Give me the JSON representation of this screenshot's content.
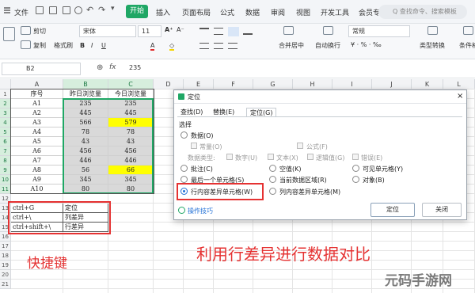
{
  "menubar": {
    "file": "文件",
    "start": "开始",
    "insert": "插入",
    "page_layout": "页面布局",
    "formula": "公式",
    "data": "数据",
    "review": "审阅",
    "view": "视图",
    "dev_tools": "开发工具",
    "member": "会员专",
    "search_placeholder": "Q 查找命令、搜索模板"
  },
  "ribbon": {
    "cut": "剪切",
    "copy": "复制",
    "format_painter": "格式刷",
    "font_name": "宋体",
    "font_size": "11",
    "merge_center": "合并居中",
    "auto_wrap": "自动换行",
    "number_format": "常规",
    "type_convert": "类型转换",
    "cond_format": "条件格"
  },
  "formula_bar": {
    "name_box": "B2",
    "fx": "fx",
    "value": "235"
  },
  "columns": [
    "A",
    "B",
    "C",
    "D",
    "E",
    "F",
    "G",
    "H",
    "I",
    "J",
    "K",
    "L"
  ],
  "rows": [
    "1",
    "2",
    "3",
    "4",
    "5",
    "6",
    "7",
    "8",
    "9",
    "10",
    "11",
    "12",
    "13",
    "14",
    "15",
    "16",
    "17",
    "18",
    "19",
    "20",
    "21"
  ],
  "table": {
    "headers": [
      "序号",
      "昨日浏览量",
      "今日浏览量"
    ],
    "rows": [
      [
        "A1",
        "235",
        "235"
      ],
      [
        "A2",
        "445",
        "445"
      ],
      [
        "A3",
        "566",
        "579"
      ],
      [
        "A4",
        "78",
        "78"
      ],
      [
        "A5",
        "43",
        "43"
      ],
      [
        "A6",
        "456",
        "456"
      ],
      [
        "A7",
        "446",
        "446"
      ],
      [
        "A8",
        "56",
        "66"
      ],
      [
        "A9",
        "345",
        "345"
      ],
      [
        "A10",
        "80",
        "80"
      ]
    ],
    "highlight_color": "#ffff00",
    "selection_fill": "#d9d9d9"
  },
  "shortcuts": [
    [
      "ctrl+G",
      "定位"
    ],
    [
      "ctrl+\\",
      "列差异"
    ],
    [
      "ctrl+shift+\\",
      "行差异"
    ]
  ],
  "dialog": {
    "title": "定位",
    "tabs": [
      "查找(D)",
      "替换(E)",
      "定位(G)"
    ],
    "section": "选择",
    "data_option": "数据(O)",
    "constant": "常量(O)",
    "formula": "公式(F)",
    "data_type": "数据类型:",
    "types": [
      "数字(U)",
      "文本(X)",
      "逻辑值(G)",
      "错误(E)"
    ],
    "options": [
      "批注(C)",
      "空值(K)",
      "可见单元格(Y)",
      "最后一个单元格(S)",
      "当前数据区域(R)",
      "对象(B)",
      "行内容差异单元格(W)",
      "列内容差异单元格(M)"
    ],
    "tips": "操作技巧",
    "ok": "定位",
    "cancel": "关闭"
  },
  "annotations": {
    "shortcut_label": "快捷键",
    "main_caption": "利用行差异进行数据对比",
    "watermark": "元码手游网"
  },
  "accent_color": "#1fa765",
  "annotation_color": "#e53232"
}
